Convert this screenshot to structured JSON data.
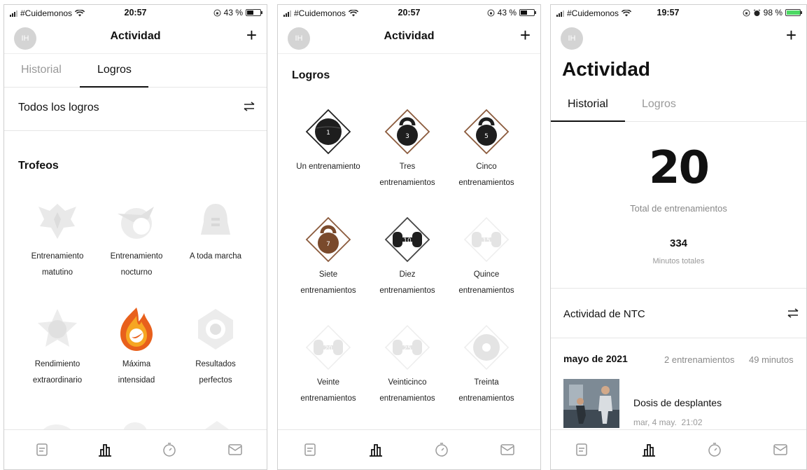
{
  "screens": [
    {
      "status": {
        "carrier": "#Cuidemonos",
        "time": "20:57",
        "battery": "43 %"
      },
      "nav": {
        "avatar": "IH",
        "title": "Actividad",
        "add_label": "+"
      },
      "tabs": [
        {
          "label": "Historial",
          "active": false
        },
        {
          "label": "Logros",
          "active": true
        }
      ],
      "filter_row_label": "Todos los logros",
      "section_title": "Trofeos",
      "badges": [
        {
          "line1": "Entrenamiento",
          "line2": "matutino",
          "icon": "eagle-trophy-icon",
          "state": "locked"
        },
        {
          "line1": "Entrenamiento",
          "line2": "nocturno",
          "icon": "moon-wing-trophy-icon",
          "state": "locked"
        },
        {
          "line1": "A toda marcha",
          "line2": "",
          "icon": "bell-trophy-icon",
          "state": "locked"
        },
        {
          "line1": "Rendimiento",
          "line2": "extraordinario",
          "icon": "star-trophy-icon",
          "state": "locked"
        },
        {
          "line1": "Máxima",
          "line2": "intensidad",
          "icon": "flame-trophy-icon",
          "state": "earned"
        },
        {
          "line1": "Resultados",
          "line2": "perfectos",
          "icon": "target-trophy-icon",
          "state": "locked"
        }
      ]
    },
    {
      "status": {
        "carrier": "#Cuidemonos",
        "time": "20:57",
        "battery": "43 %"
      },
      "nav": {
        "avatar": "IH",
        "title": "Actividad",
        "add_label": "+"
      },
      "section_title": "Logros",
      "badges": [
        {
          "line1": "Un entrenamiento",
          "line2": "",
          "number": "1",
          "kind": "ball",
          "color": "#1e1e1e",
          "frame": "#222222",
          "state": "earned"
        },
        {
          "line1": "Tres",
          "line2": "entrenamientos",
          "number": "3",
          "kind": "kettlebell",
          "color": "#1e1e1e",
          "frame": "#8b5a3c",
          "state": "earned"
        },
        {
          "line1": "Cinco",
          "line2": "entrenamientos",
          "number": "5",
          "kind": "kettlebell",
          "color": "#1e1e1e",
          "frame": "#8b5a3c",
          "state": "earned"
        },
        {
          "line1": "Siete",
          "line2": "entrenamientos",
          "number": "7",
          "kind": "kettlebell",
          "color": "#7a4a2c",
          "frame": "#8b5a3c",
          "state": "earned"
        },
        {
          "line1": "Diez",
          "line2": "entrenamientos",
          "number": "10",
          "kind": "dumbbell",
          "color": "#1e1e1e",
          "frame": "#444444",
          "state": "earned"
        },
        {
          "line1": "Quince",
          "line2": "entrenamientos",
          "number": "15",
          "kind": "dumbbell",
          "color": "#e4e4e4",
          "frame": "#ededed",
          "state": "locked"
        },
        {
          "line1": "Veinte",
          "line2": "entrenamientos",
          "number": "20",
          "kind": "dumbbell",
          "color": "#e4e4e4",
          "frame": "#ededed",
          "state": "locked"
        },
        {
          "line1": "Veinticinco",
          "line2": "entrenamientos",
          "number": "25",
          "kind": "dumbbell",
          "color": "#e4e4e4",
          "frame": "#ededed",
          "state": "locked"
        },
        {
          "line1": "Treinta",
          "line2": "entrenamientos",
          "number": "30",
          "kind": "plate",
          "color": "#e4e4e4",
          "frame": "#ededed",
          "state": "locked"
        }
      ]
    },
    {
      "status": {
        "carrier": "#Cuidemonos",
        "time": "19:57",
        "battery": "98 %"
      },
      "nav": {
        "avatar": "IH",
        "add_label": "+"
      },
      "large_title": "Actividad",
      "tabs": [
        {
          "label": "Historial",
          "active": true
        },
        {
          "label": "Logros",
          "active": false
        }
      ],
      "stats": {
        "total_workouts": "20",
        "total_workouts_label": "Total de entrenamientos",
        "total_minutes": "334",
        "total_minutes_label": "Minutos totales"
      },
      "activity_row_label": "Actividad de NTC",
      "month": {
        "label": "mayo de 2021",
        "workouts": "2 entrenamientos",
        "minutes": "49 minutos"
      },
      "workout": {
        "title": "Dosis de desplantes",
        "date": "mar, 4 may.",
        "time": "21:02"
      }
    }
  ],
  "bottom_nav": [
    {
      "icon": "feed-icon",
      "active": false
    },
    {
      "icon": "activity-chart-icon",
      "active": true
    },
    {
      "icon": "timer-icon",
      "active": false
    },
    {
      "icon": "inbox-icon",
      "active": false
    }
  ],
  "colors": {
    "accent": "#111111",
    "inactive": "#9a9a9a",
    "locked": "#e6e6e6",
    "flame": "#e8601c"
  }
}
